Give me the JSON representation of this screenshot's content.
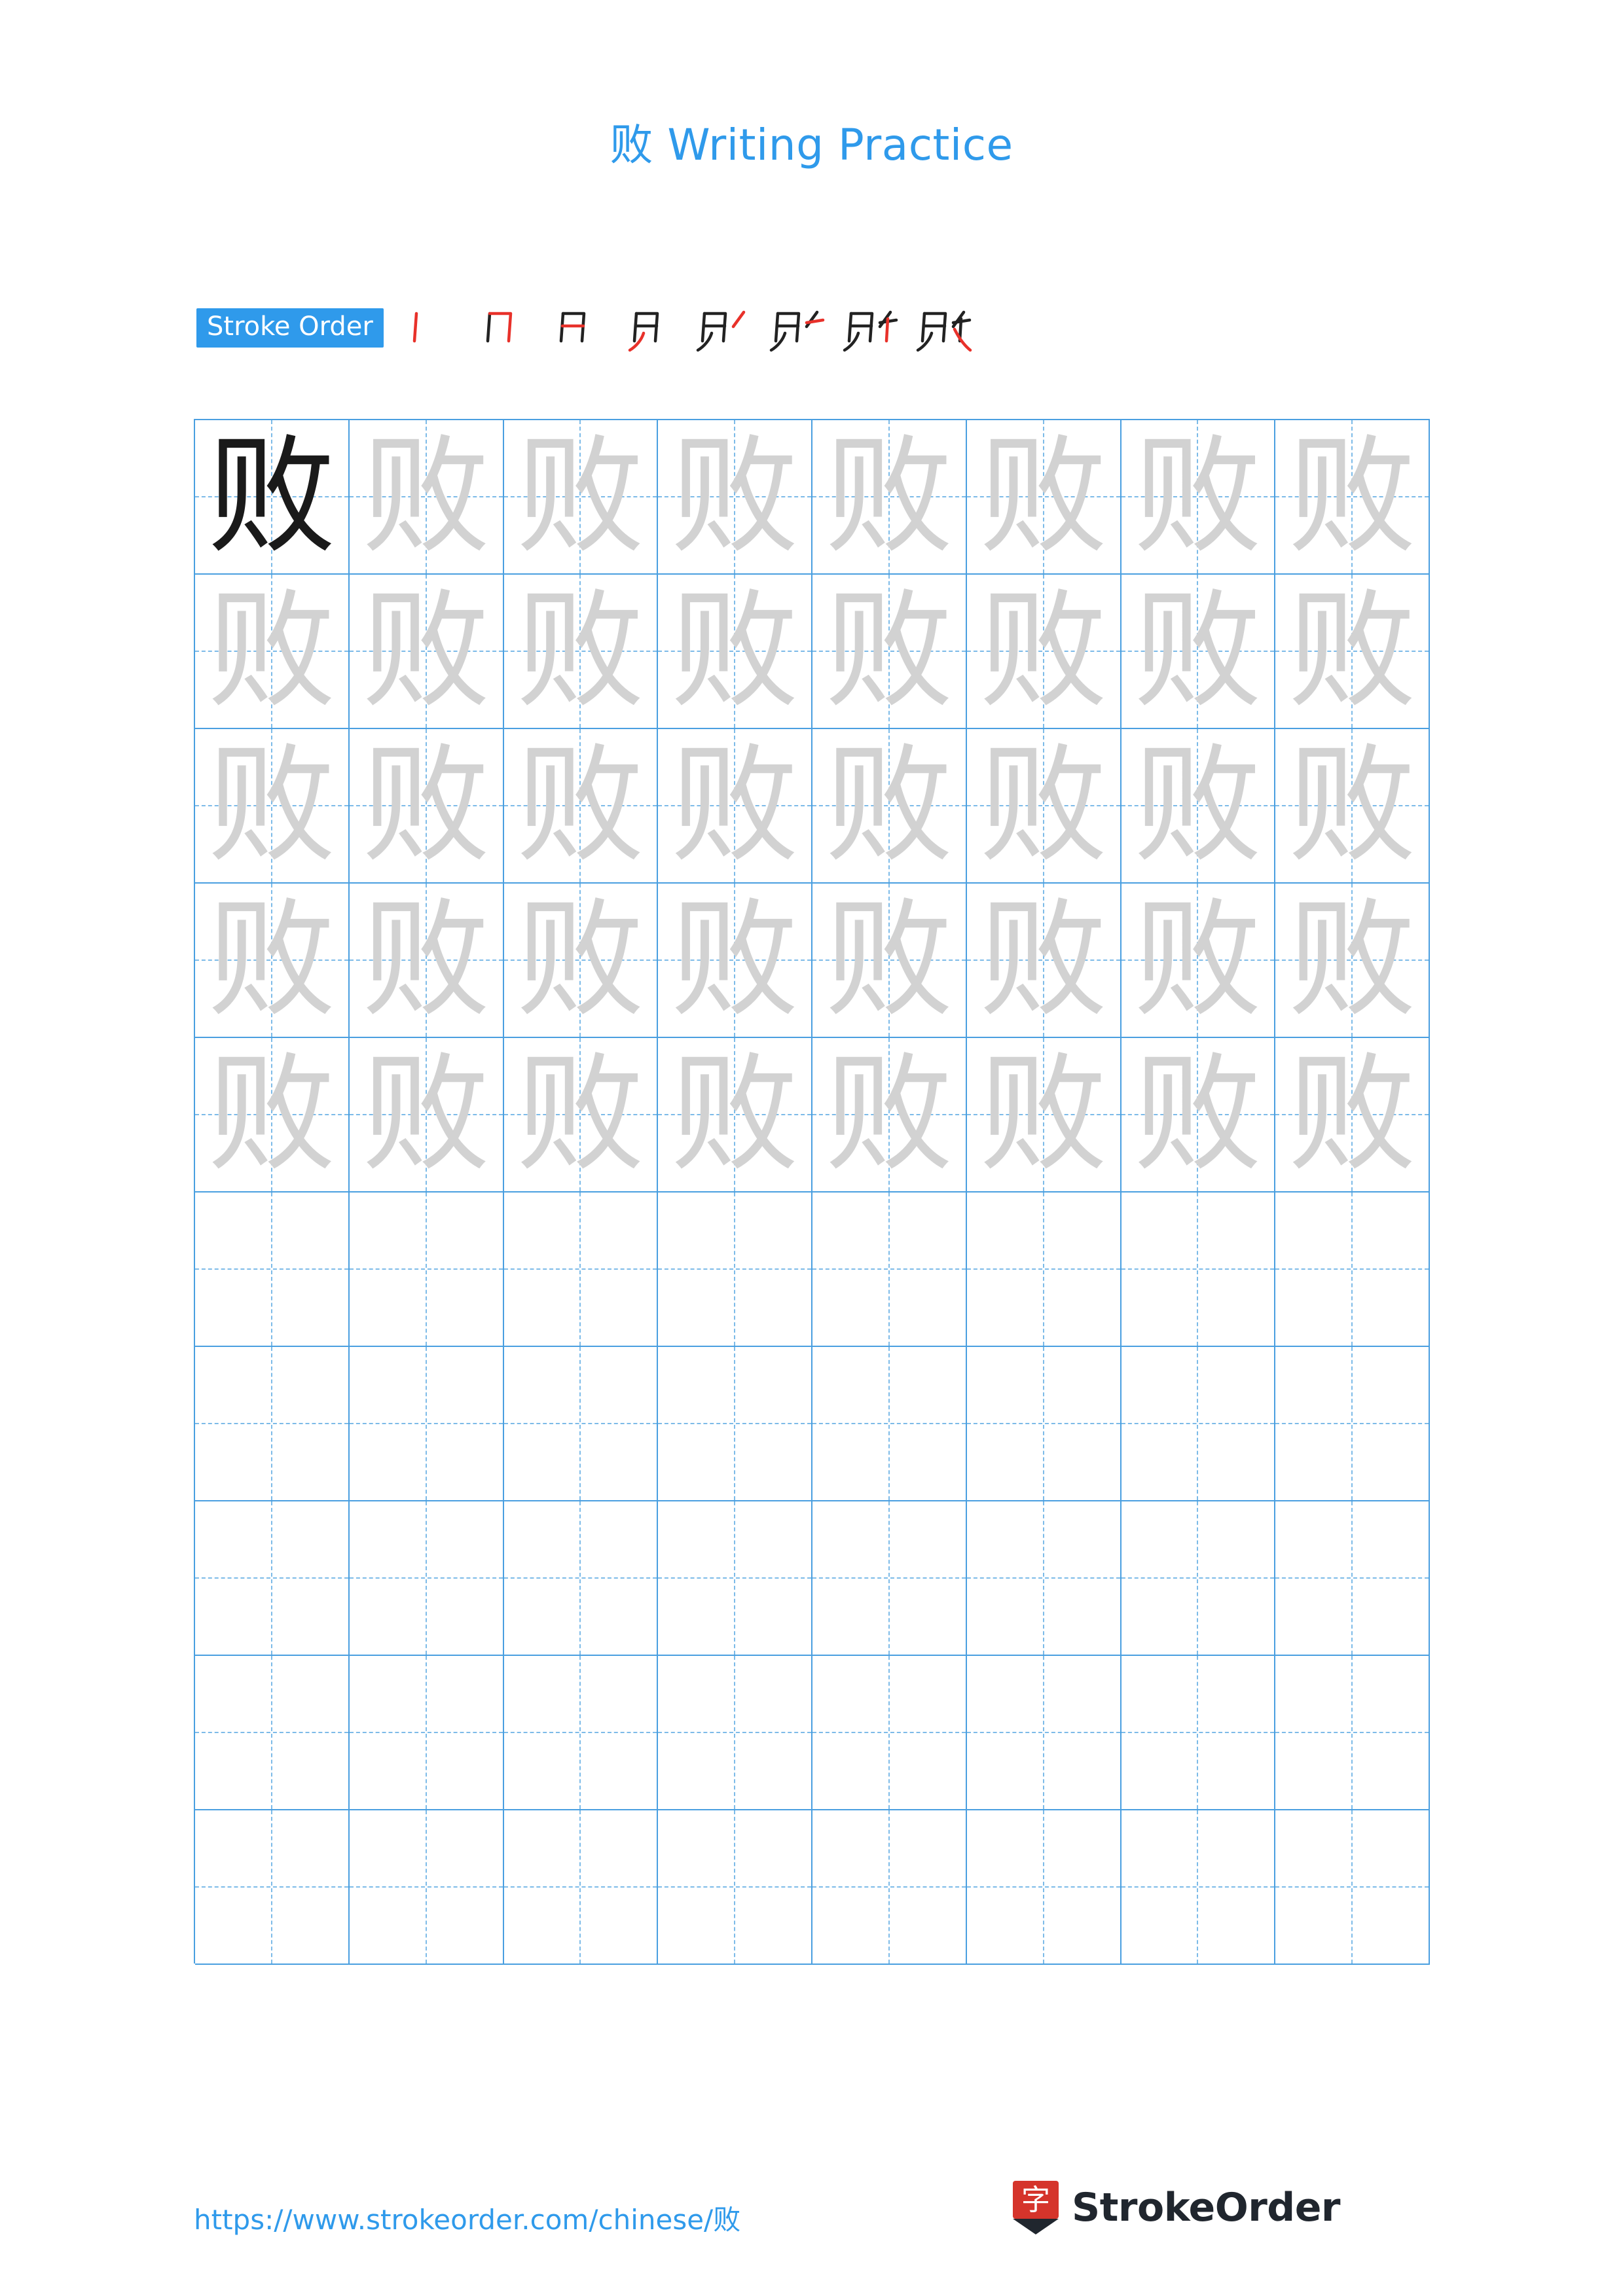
{
  "document": {
    "character": "败",
    "title_prefix": "败",
    "title_text": "Writing Practice",
    "accent_color": "#2f9aeb",
    "grid_line_color": "#4a9fe0",
    "guide_line_color": "#7dbbe8",
    "traced_glyph_color": "#d2d2d2",
    "model_glyph_color": "#1a1a1a"
  },
  "stroke_order": {
    "label": "Stroke Order",
    "stroke_count": 8,
    "new_stroke_color": "#e8312a",
    "existing_stroke_color": "#222222",
    "steps": [
      {
        "index": 1,
        "partial": "丨"
      },
      {
        "index": 2,
        "partial": "冂"
      },
      {
        "index": 3,
        "partial": "月"
      },
      {
        "index": 4,
        "partial": "贝"
      },
      {
        "index": 5,
        "partial": "贝丿"
      },
      {
        "index": 6,
        "partial": "贬"
      },
      {
        "index": 7,
        "partial": "贮"
      },
      {
        "index": 8,
        "partial": "败"
      }
    ]
  },
  "practice_grid": {
    "columns": 8,
    "rows": 10,
    "rows_data": [
      {
        "cells": [
          {
            "glyph": "败",
            "style": "dark"
          },
          {
            "glyph": "败",
            "style": "light"
          },
          {
            "glyph": "败",
            "style": "light"
          },
          {
            "glyph": "败",
            "style": "light"
          },
          {
            "glyph": "败",
            "style": "light"
          },
          {
            "glyph": "败",
            "style": "light"
          },
          {
            "glyph": "败",
            "style": "light"
          },
          {
            "glyph": "败",
            "style": "light"
          }
        ]
      },
      {
        "cells": [
          {
            "glyph": "败",
            "style": "light"
          },
          {
            "glyph": "败",
            "style": "light"
          },
          {
            "glyph": "败",
            "style": "light"
          },
          {
            "glyph": "败",
            "style": "light"
          },
          {
            "glyph": "败",
            "style": "light"
          },
          {
            "glyph": "败",
            "style": "light"
          },
          {
            "glyph": "败",
            "style": "light"
          },
          {
            "glyph": "败",
            "style": "light"
          }
        ]
      },
      {
        "cells": [
          {
            "glyph": "败",
            "style": "light"
          },
          {
            "glyph": "败",
            "style": "light"
          },
          {
            "glyph": "败",
            "style": "light"
          },
          {
            "glyph": "败",
            "style": "light"
          },
          {
            "glyph": "败",
            "style": "light"
          },
          {
            "glyph": "败",
            "style": "light"
          },
          {
            "glyph": "败",
            "style": "light"
          },
          {
            "glyph": "败",
            "style": "light"
          }
        ]
      },
      {
        "cells": [
          {
            "glyph": "败",
            "style": "light"
          },
          {
            "glyph": "败",
            "style": "light"
          },
          {
            "glyph": "败",
            "style": "light"
          },
          {
            "glyph": "败",
            "style": "light"
          },
          {
            "glyph": "败",
            "style": "light"
          },
          {
            "glyph": "败",
            "style": "light"
          },
          {
            "glyph": "败",
            "style": "light"
          },
          {
            "glyph": "败",
            "style": "light"
          }
        ]
      },
      {
        "cells": [
          {
            "glyph": "败",
            "style": "light"
          },
          {
            "glyph": "败",
            "style": "light"
          },
          {
            "glyph": "败",
            "style": "light"
          },
          {
            "glyph": "败",
            "style": "light"
          },
          {
            "glyph": "败",
            "style": "light"
          },
          {
            "glyph": "败",
            "style": "light"
          },
          {
            "glyph": "败",
            "style": "light"
          },
          {
            "glyph": "败",
            "style": "light"
          }
        ]
      },
      {
        "cells": [
          {
            "glyph": "",
            "style": "empty"
          },
          {
            "glyph": "",
            "style": "empty"
          },
          {
            "glyph": "",
            "style": "empty"
          },
          {
            "glyph": "",
            "style": "empty"
          },
          {
            "glyph": "",
            "style": "empty"
          },
          {
            "glyph": "",
            "style": "empty"
          },
          {
            "glyph": "",
            "style": "empty"
          },
          {
            "glyph": "",
            "style": "empty"
          }
        ]
      },
      {
        "cells": [
          {
            "glyph": "",
            "style": "empty"
          },
          {
            "glyph": "",
            "style": "empty"
          },
          {
            "glyph": "",
            "style": "empty"
          },
          {
            "glyph": "",
            "style": "empty"
          },
          {
            "glyph": "",
            "style": "empty"
          },
          {
            "glyph": "",
            "style": "empty"
          },
          {
            "glyph": "",
            "style": "empty"
          },
          {
            "glyph": "",
            "style": "empty"
          }
        ]
      },
      {
        "cells": [
          {
            "glyph": "",
            "style": "empty"
          },
          {
            "glyph": "",
            "style": "empty"
          },
          {
            "glyph": "",
            "style": "empty"
          },
          {
            "glyph": "",
            "style": "empty"
          },
          {
            "glyph": "",
            "style": "empty"
          },
          {
            "glyph": "",
            "style": "empty"
          },
          {
            "glyph": "",
            "style": "empty"
          },
          {
            "glyph": "",
            "style": "empty"
          }
        ]
      },
      {
        "cells": [
          {
            "glyph": "",
            "style": "empty"
          },
          {
            "glyph": "",
            "style": "empty"
          },
          {
            "glyph": "",
            "style": "empty"
          },
          {
            "glyph": "",
            "style": "empty"
          },
          {
            "glyph": "",
            "style": "empty"
          },
          {
            "glyph": "",
            "style": "empty"
          },
          {
            "glyph": "",
            "style": "empty"
          },
          {
            "glyph": "",
            "style": "empty"
          }
        ]
      },
      {
        "cells": [
          {
            "glyph": "",
            "style": "empty"
          },
          {
            "glyph": "",
            "style": "empty"
          },
          {
            "glyph": "",
            "style": "empty"
          },
          {
            "glyph": "",
            "style": "empty"
          },
          {
            "glyph": "",
            "style": "empty"
          },
          {
            "glyph": "",
            "style": "empty"
          },
          {
            "glyph": "",
            "style": "empty"
          },
          {
            "glyph": "",
            "style": "empty"
          }
        ]
      }
    ]
  },
  "footer": {
    "url": "https://www.strokeorder.com/chinese/败",
    "brand_name": "StrokeOrder",
    "brand_logo_character": "字",
    "brand_logo_color": "#d5342b"
  }
}
